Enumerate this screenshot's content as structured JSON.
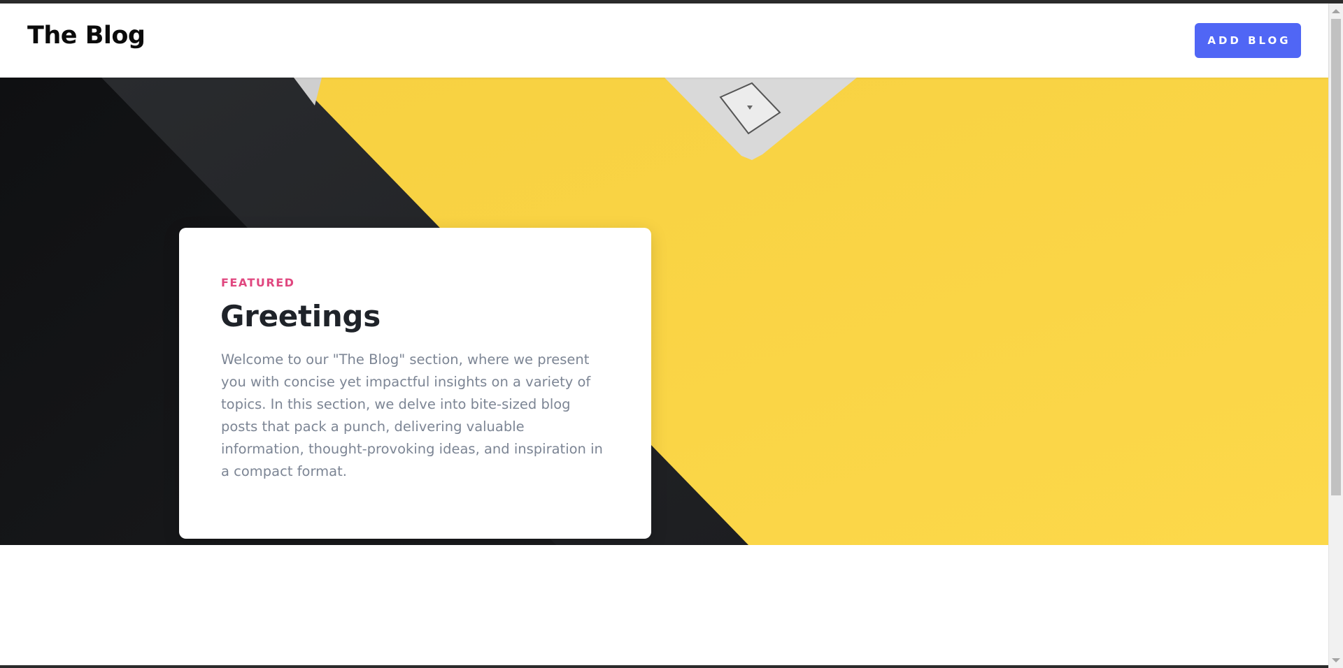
{
  "header": {
    "logo": "The Blog",
    "add_button_label": "ADD BLOG"
  },
  "featured_card": {
    "tag": "FEATURED",
    "title": "Greetings",
    "body": "Welcome to our \"The Blog\" section, where we present you with concise yet impactful insights on a variety of topics. In this section, we delve into bite-sized blog posts that pack a punch, delivering valuable information, thought-provoking ideas, and inspiration in a compact format."
  },
  "colors": {
    "accent": "#5066f5",
    "tag": "#e0477f",
    "hero_yellow": "#fbd442",
    "hero_dark": "#1c1d1f"
  },
  "icons": {
    "scroll_up": "scroll-up-arrow-icon",
    "scroll_down": "scroll-down-arrow-icon"
  }
}
